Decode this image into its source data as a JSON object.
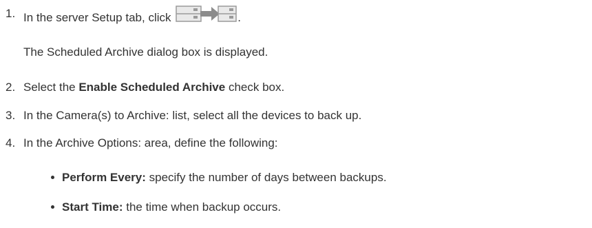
{
  "steps": [
    {
      "number": "1.",
      "text_before_icon": "In the server Setup tab, click",
      "icon": "archive-icon",
      "text_after_icon": ".",
      "result": "The Scheduled Archive dialog box is displayed."
    },
    {
      "number": "2.",
      "prefix": "Select the ",
      "bold": "Enable Scheduled Archive",
      "suffix": " check box."
    },
    {
      "number": "3.",
      "text": "In the Camera(s) to Archive: list, select all the devices to back up."
    },
    {
      "number": "4.",
      "text": "In the Archive Options: area, define the following:",
      "bullets": [
        {
          "bold": "Perform Every:",
          "text": " specify the number of days between backups."
        },
        {
          "bold": "Start Time:",
          "text": " the time when backup occurs."
        }
      ]
    }
  ]
}
